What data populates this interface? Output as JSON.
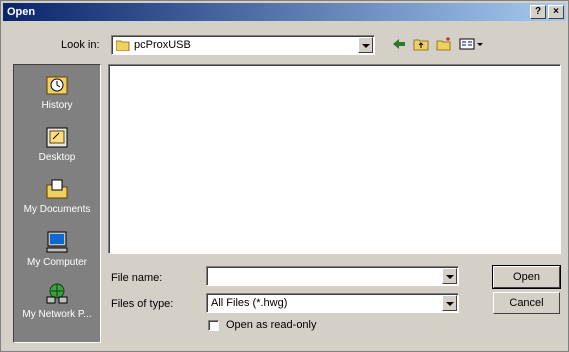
{
  "window": {
    "title": "Open",
    "help_label": "?",
    "close_label": "×"
  },
  "toolbar": {
    "look_in_label": "Look in:",
    "look_in_value": "pcProxUSB",
    "icons": [
      "back-arrow-icon",
      "up-folder-icon",
      "new-folder-icon",
      "view-menu-icon"
    ]
  },
  "places": [
    {
      "label": "History",
      "icon": "history-icon"
    },
    {
      "label": "Desktop",
      "icon": "desktop-icon"
    },
    {
      "label": "My Documents",
      "icon": "my-documents-icon"
    },
    {
      "label": "My Computer",
      "icon": "my-computer-icon"
    },
    {
      "label": "My Network P...",
      "icon": "my-network-icon"
    }
  ],
  "form": {
    "file_name_label": "File name:",
    "file_name_value": "",
    "files_of_type_label": "Files of type:",
    "files_of_type_value": "All Files (*.hwg)",
    "read_only_label": "Open as read-only"
  },
  "buttons": {
    "open": "Open",
    "cancel": "Cancel"
  }
}
